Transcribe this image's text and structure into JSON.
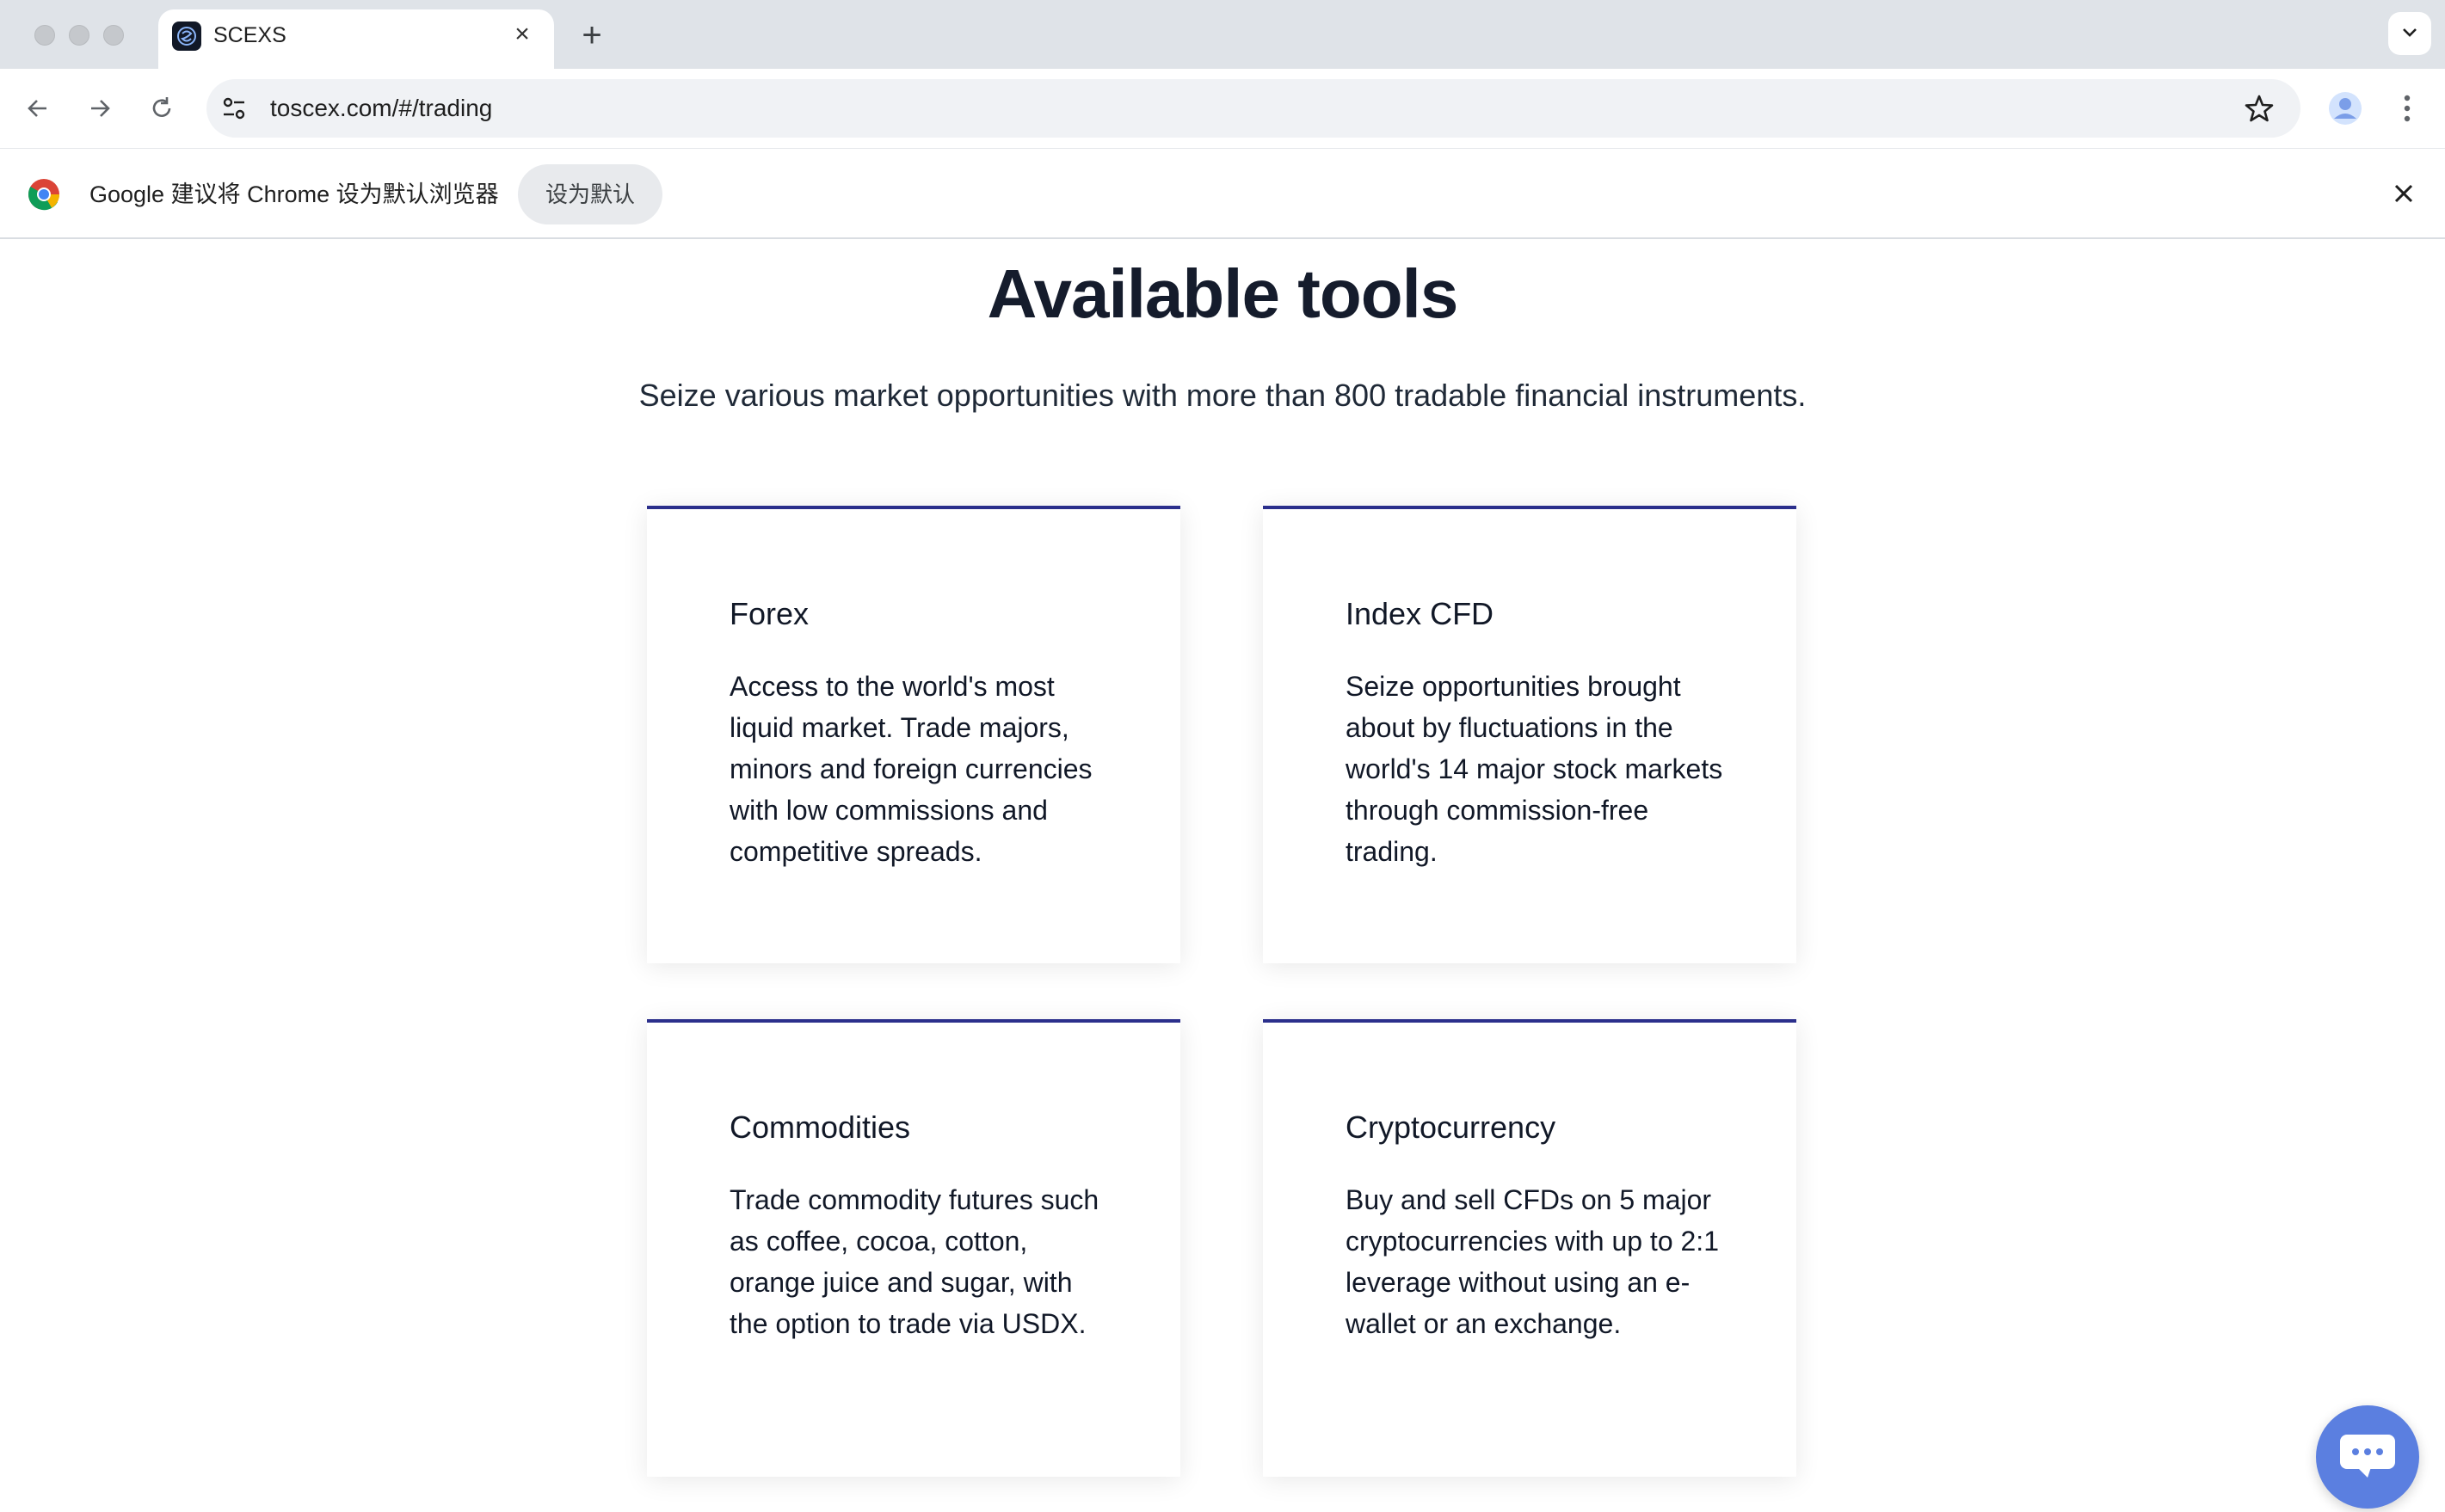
{
  "browser": {
    "tab": {
      "title": "SCEXS"
    },
    "address_bar": {
      "url": "toscex.com/#/trading"
    },
    "infobar": {
      "message": "Google 建议将 Chrome 设为默认浏览器",
      "button_label": "设为默认"
    }
  },
  "page": {
    "heading": "Available tools",
    "subheading": "Seize various market opportunities with more than 800 tradable financial instruments.",
    "accent_color": "#2b2f8c",
    "cards": [
      {
        "title": "Forex",
        "body": "Access to the world's most liquid market. Trade majors, minors and foreign currencies with low commissions and competitive spreads."
      },
      {
        "title": "Index CFD",
        "body": "Seize opportunities brought about by fluctuations in the world's 14 major stock markets through commission-free trading."
      },
      {
        "title": "Commodities",
        "body": "Trade commodity futures such as coffee, cocoa, cotton, orange juice and sugar, with the option to trade via USDX."
      },
      {
        "title": "Cryptocurrency",
        "body": "Buy and sell CFDs on 5 major cryptocurrencies with up to 2:1 leverage without using an e-wallet or an exchange."
      }
    ]
  },
  "chat_widget": {
    "icon": "chat-bubble-icon",
    "color": "#5b7fe0"
  }
}
